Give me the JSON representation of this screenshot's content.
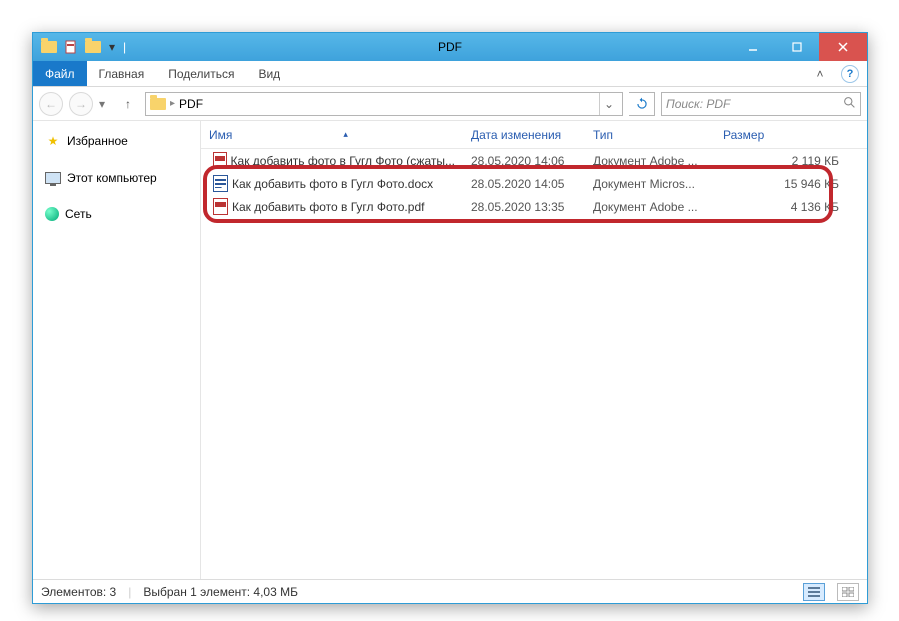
{
  "title": "PDF",
  "ribbon": {
    "file": "Файл",
    "tabs": [
      "Главная",
      "Поделиться",
      "Вид"
    ]
  },
  "breadcrumb": {
    "current": "PDF"
  },
  "search": {
    "placeholder": "Поиск: PDF"
  },
  "sidebar": {
    "favorites": "Избранное",
    "computer": "Этот компьютер",
    "network": "Сеть"
  },
  "columns": {
    "name": "Имя",
    "date": "Дата изменения",
    "type": "Тип",
    "size": "Размер"
  },
  "files": [
    {
      "name": "Как добавить фото в Гугл Фото (сжаты...",
      "date": "28.05.2020 14:06",
      "type": "Документ Adobe ...",
      "size": "2 119 КБ",
      "kind": "pdf"
    },
    {
      "name": "Как добавить фото в Гугл Фото.docx",
      "date": "28.05.2020 14:05",
      "type": "Документ Micros...",
      "size": "15 946 КБ",
      "kind": "doc"
    },
    {
      "name": "Как добавить фото в Гугл Фото.pdf",
      "date": "28.05.2020 13:35",
      "type": "Документ Adobe ...",
      "size": "4 136 КБ",
      "kind": "pdf"
    }
  ],
  "status": {
    "count": "Элементов: 3",
    "selection": "Выбран 1 элемент: 4,03 МБ"
  }
}
